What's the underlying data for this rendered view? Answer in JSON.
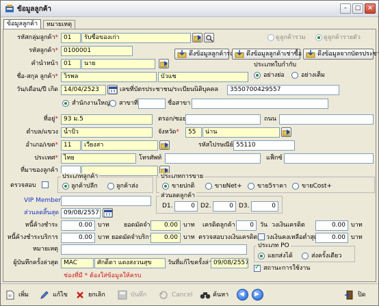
{
  "window": {
    "title": "ข้อมูลลูกค้า",
    "tabs": [
      "ข้อมูลลูกค้า",
      "หมายเหตุ"
    ]
  },
  "form": {
    "customer_type_label": "รหัสกลุ่มลูกค้า",
    "customer_type_code": "01",
    "customer_type_name": "รับซื้อของเก่า",
    "customer_code_label": "รหัสลูกค้า",
    "customer_code": "0100001",
    "title_label": "คำนำหน้า",
    "title_code": "01",
    "title_name": "นาย",
    "name_label": "ชื่อ-สกุล ลูกค้า",
    "first_name": "วิรพล",
    "last_name": "บัวแซ",
    "dob_label": "วัน/เดือน/ปี เกิด",
    "dob": "14/04/2523",
    "taxid_label": "เลขที่บัตรประชาชน/ระเบียนนิติบุคคล",
    "taxid": "3550700429557",
    "view_group_all": "ดูลูกค้ารวม",
    "view_per_customer": "ดูลูกค้ารายตัว",
    "btn_card_reader": "ดึงข้อมูลลูกค้ารถ",
    "btn_copy_customer": "ดึงข้อมูลลูกค้าเช่าซื้อ",
    "btn_idcard": "ดึงข้อมูลจากบัตรประชาชน",
    "branch_type_label": "ประเภทใบกำกับ",
    "branch_short": "อย่างย่อ",
    "branch_full": "อย่างเต็ม",
    "head_office": "สำนักงานใหญ่",
    "branch": "สาขาที่",
    "branch_name_label": "ชื่อสาขา",
    "address_label": "ที่อยู่",
    "address": "93 ม.5",
    "soi_label": "ตรอก/ซอย",
    "road_label": "ถนน",
    "subdistrict_label": "ตำบล/แขวง",
    "subdistrict": "น้ำปั้ว",
    "province_label": "จังหวัด",
    "province_code": "55",
    "province_name": "น่าน",
    "district_label": "อำเภอ/เขต",
    "district_code": "11",
    "district_name": "เวียงสา",
    "zip_label": "รหัสไปรษณีย์",
    "zip": "55110",
    "country_label": "ประเทศ",
    "country": "ไทย",
    "phone_label": "โทรศัพท์",
    "fax_label": "แฟ็กซ์",
    "source_label": "ที่มาของลูกค้า",
    "verify_label": "ตรวจสอบ",
    "cust_kind_label": "ประเภทลูกค้า",
    "cust_retail": "ลูกค้าปลีก",
    "cust_wholesale": "ลูกค้าส่ง",
    "sale_type_label": "ประเภทการขาย",
    "sale_normal": "ขายปกติ",
    "sale_net": "ขายNet+",
    "sale_5price": "ขาย5ราคา",
    "sale_cost": "ขายCost+",
    "vip_label": "VIP Member ID",
    "discount_label": "ส่วนลดลูกค้า",
    "d1_label": "D1.",
    "d1": "0",
    "d2_label": "D2.",
    "d2": "0",
    "d3_label": "D3.",
    "d3": "0",
    "last_discount_label": "ส่วนลดสิ้นสุด",
    "last_discount_date": "09/08/2557",
    "debt_label": "หนี้ค้างชำระ",
    "debt": "0.00",
    "baht": "บาท",
    "deposit_label": "ยอดมัดจำ",
    "deposit": "0.00",
    "credit_label": "เครดิตลูกค้า",
    "credit": "0",
    "day": "วัน",
    "credit_limit_label": "วงเงินเครดิต",
    "credit_limit": "0.00",
    "service_debt_label": "หนี้ค้างชำระบริการ",
    "service_debt": "0.00",
    "service_deposit_label": "ยอดมัดจำบริการ",
    "service_deposit": "0.00",
    "check_credit_label": "ตรวจสอบวงเงินเครดิต",
    "credit_balance_label": "วงเงินคงเหลือต่ำสุด",
    "credit_balance": "0.00",
    "note_label": "หมายเหตุ",
    "po_type_label": "ประเภท PO",
    "po_split": "แยกส่งได้",
    "po_once": "ส่งครั้งเดียว",
    "recorder_label": "ผู้บันทึกครั้งล่าสุด",
    "recorder_code": "MAC",
    "recorder_name": "ศักดิ์ดา แดงสงวนสุข",
    "last_edit_label": "วันที่แก้ไขครั้งล่าสุด",
    "last_edit_date": "09/08/2557",
    "active_label": "สถานะการใช้งาน",
    "footer_note": "ช่องที่มี * ต้องใส่ข้อมูลให้ครบ"
  },
  "toolbar": {
    "add": "เพิ่ม",
    "edit": "แก้ไข",
    "cancel_record": "ยกเลิก",
    "save": "บันทึก",
    "cancel": "Cancel",
    "search": "ค้นหา",
    "close": "ปิด"
  }
}
